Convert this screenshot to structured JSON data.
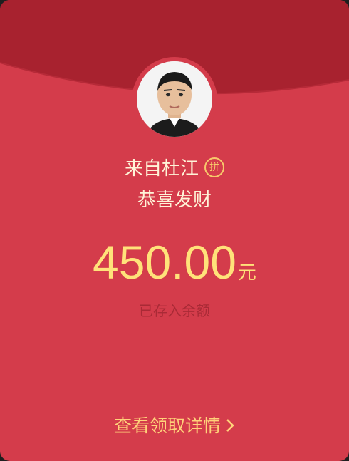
{
  "sender": {
    "prefix": "来自杜江",
    "badge": "拼"
  },
  "greeting": "恭喜发财",
  "amount": {
    "value": "450.00",
    "unit": "元"
  },
  "deposit_note": "已存入余额",
  "details_link": "查看领取详情",
  "colors": {
    "background": "#d43c4b",
    "flap": "#a8222f",
    "amount": "#ffe27a",
    "link": "#ffd27a",
    "note": "#a92a36"
  },
  "icons": {
    "badge": "pin-group-icon",
    "chevron": "chevron-right-icon"
  }
}
